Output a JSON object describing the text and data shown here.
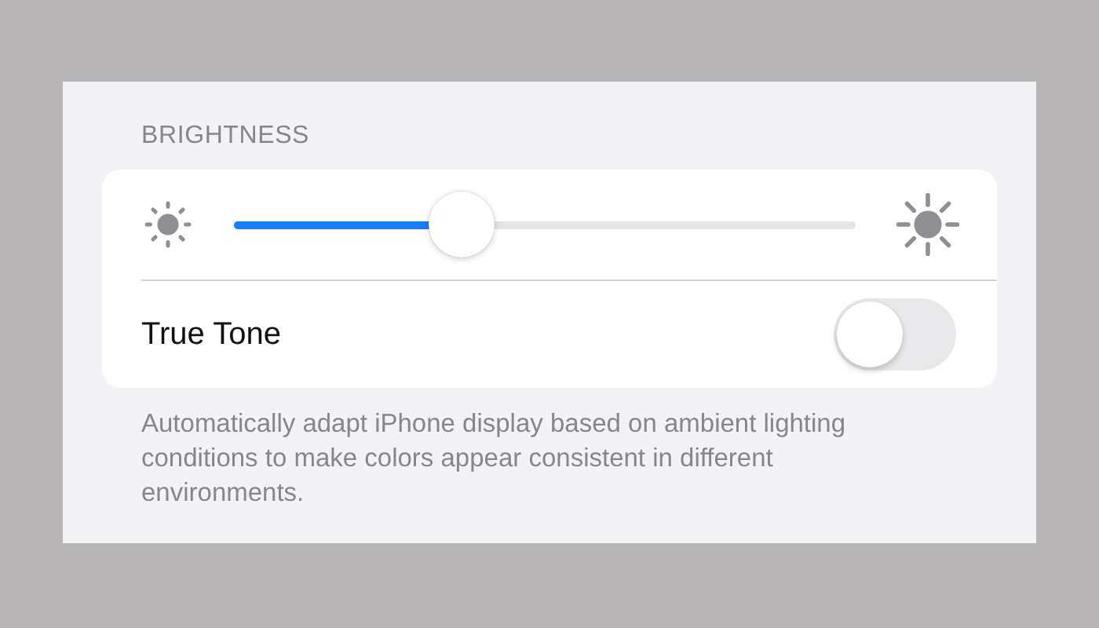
{
  "section_header": "BRIGHTNESS",
  "brightness": {
    "level": 0.35
  },
  "true_tone": {
    "label": "True Tone",
    "on": false
  },
  "footer": "Automatically adapt iPhone display based on ambient lighting conditions to make colors appear consistent in different environments."
}
